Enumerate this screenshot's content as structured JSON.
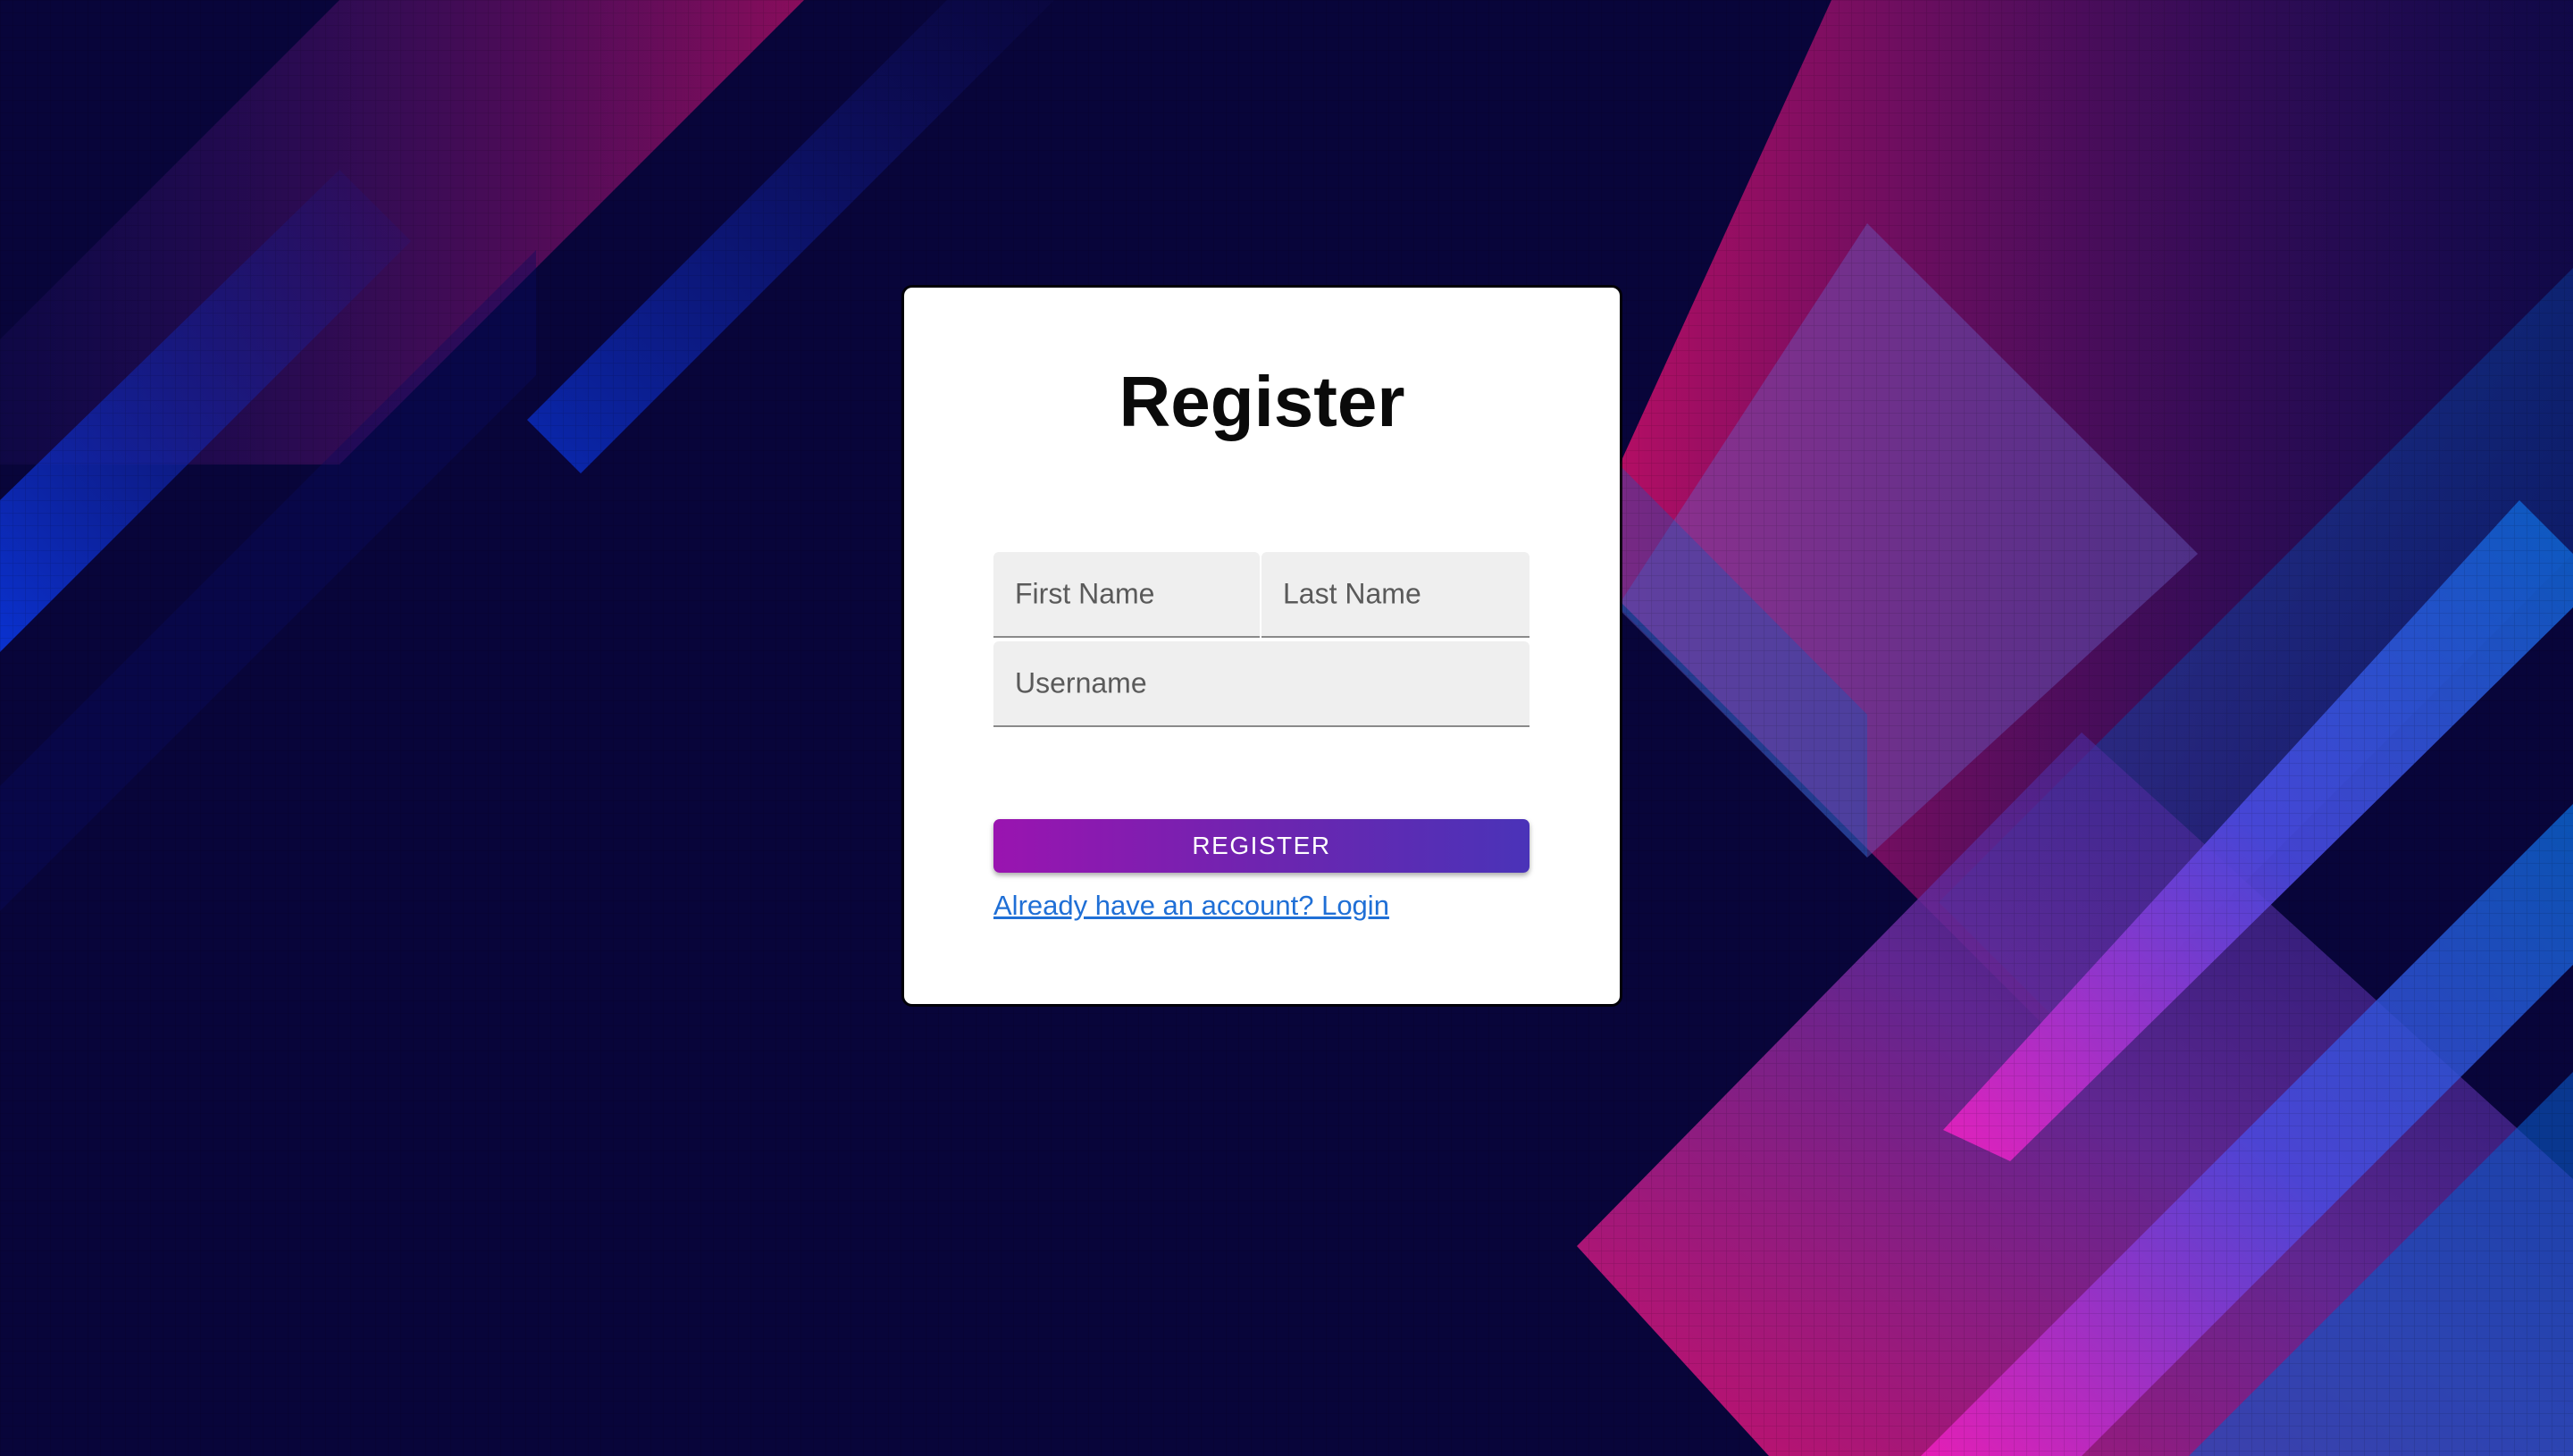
{
  "register_form": {
    "title": "Register",
    "first_name_placeholder": "First Name",
    "last_name_placeholder": "Last Name",
    "username_placeholder": "Username",
    "submit_label": "REGISTER",
    "login_link": "Already have an account? Login"
  },
  "colors": {
    "background": "#08053a",
    "accent_magenta": "#d0106a",
    "accent_blue": "#1a3fd0",
    "button_start": "#9a14b0",
    "button_end": "#4a33b8",
    "link": "#1f6fd6"
  }
}
